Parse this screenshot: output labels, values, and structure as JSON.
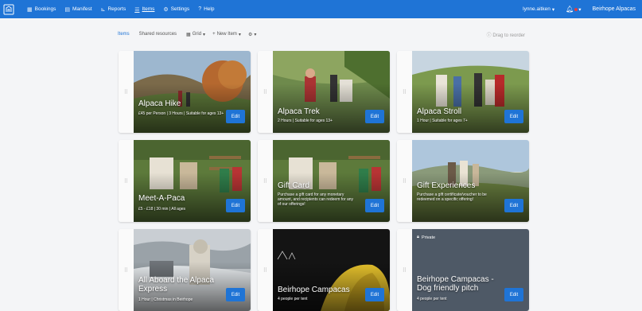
{
  "nav": {
    "items": [
      {
        "icon": "calendar-icon",
        "glyph": "▦",
        "label": "Bookings"
      },
      {
        "icon": "clipboard-icon",
        "glyph": "▤",
        "label": "Manifest"
      },
      {
        "icon": "chart-icon",
        "glyph": "⊾",
        "label": "Reports"
      },
      {
        "icon": "list-icon",
        "glyph": "☰",
        "label": "Items"
      },
      {
        "icon": "gear-icon",
        "glyph": "⚙",
        "label": "Settings"
      },
      {
        "icon": "help-icon",
        "glyph": "?",
        "label": "Help"
      }
    ],
    "user": "lynne.aitken",
    "company": "Beirhope Alpacas",
    "bell_icon": "bell-icon",
    "colors": {
      "bar": "#1f74d6",
      "notification": "#e23d3d"
    }
  },
  "toolbar": {
    "tab_items": "Items",
    "tab_shared": "Shared resources",
    "grid_label": "Grid",
    "new_item_label": "New Item",
    "settings_icon": "gear-icon",
    "drag_hint": "Drag to reorder"
  },
  "cards": [
    {
      "title": "Alpaca Hike",
      "detail": "£45 per Person | 3 Hours | Suitable for ages 13+",
      "edit": "Edit"
    },
    {
      "title": "Alpaca Trek",
      "detail": "2 Hours | Suitable for ages 13+",
      "edit": "Edit"
    },
    {
      "title": "Alpaca Stroll",
      "detail": "1 Hour | Suitable for ages 7+",
      "edit": "Edit"
    },
    {
      "title": "Meet-A-Paca",
      "detail": "£5 - £18 | 30 min | All ages",
      "edit": "Edit"
    },
    {
      "title": "Gift Card",
      "detail": "Purchase a gift card for any monetary amount, and recipients can redeem for any of our offerings!",
      "edit": "Edit"
    },
    {
      "title": "Gift Experiences",
      "detail": "Purchase a gift certificate/voucher to be redeemed on a specific offering!",
      "edit": "Edit"
    },
    {
      "title": "All Aboard the Alpaca Express",
      "detail": "1 Hour | Christmas in Beirhope",
      "edit": "Edit"
    },
    {
      "title": "Beirhope Campacas",
      "detail": "4 people per tent",
      "edit": "Edit"
    },
    {
      "title": "Beirhope Campacas - Dog friendly pitch",
      "detail": "4 people per tent",
      "edit": "Edit",
      "badge": "Private"
    }
  ]
}
